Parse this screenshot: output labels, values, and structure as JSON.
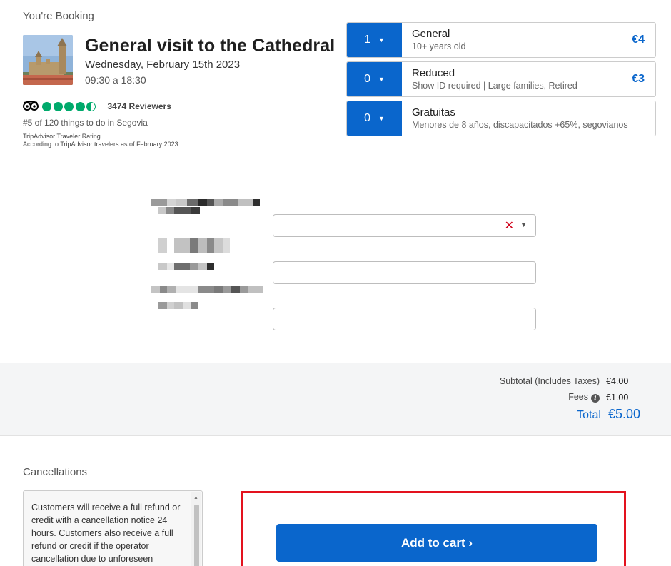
{
  "booking": {
    "heading": "You're Booking",
    "title": "General visit to the Cathedral",
    "date": "Wednesday, February 15th 2023",
    "time": "09:30 a 18:30"
  },
  "rating": {
    "score_bubbles": 4.5,
    "reviewers": "3474 Reviewers",
    "rank": "#5 of 120 things to do in Segovia",
    "source_line1": "TripAdvisor Traveler Rating",
    "source_line2": "According to TripAdvisor travelers as of February 2023",
    "bubble_color": "#00aa6c"
  },
  "tickets": [
    {
      "qty": "1",
      "name": "General",
      "desc": "10+ years old",
      "price": "€4"
    },
    {
      "qty": "0",
      "name": "Reduced",
      "desc": "Show ID required | Large families, Retired",
      "price": "€3"
    },
    {
      "qty": "0",
      "name": "Gratuitas",
      "desc": "Menores de 8 años, discapacitados +65%, segovianos",
      "price": ""
    }
  ],
  "totals": {
    "subtotal_label": "Subtotal (Includes Taxes)",
    "subtotal_value": "€4.00",
    "fees_label": "Fees",
    "fees_value": "€1.00",
    "total_label": "Total",
    "total_value": "€5.00"
  },
  "cancellations": {
    "title": "Cancellations",
    "text": "Customers will receive a full refund or credit with a cancellation notice 24 hours. Customers also receive a full refund or credit if the operator cancellation due to unforeseen circumstances affecting the tour."
  },
  "cart": {
    "label": "Add to cart ›"
  },
  "colors": {
    "accent": "#0a66cc",
    "highlight": "#e3121e",
    "clear": "#d0021b"
  },
  "icons": {
    "caret": "caret-down-icon",
    "clear": "clear-x-icon",
    "info": "info-icon",
    "tripadvisor": "tripadvisor-owl-icon"
  }
}
